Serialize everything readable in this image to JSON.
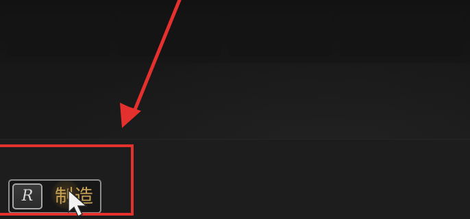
{
  "prompt": {
    "key": "R",
    "action": "制造"
  },
  "annotation": {
    "color": "#e5312d"
  }
}
